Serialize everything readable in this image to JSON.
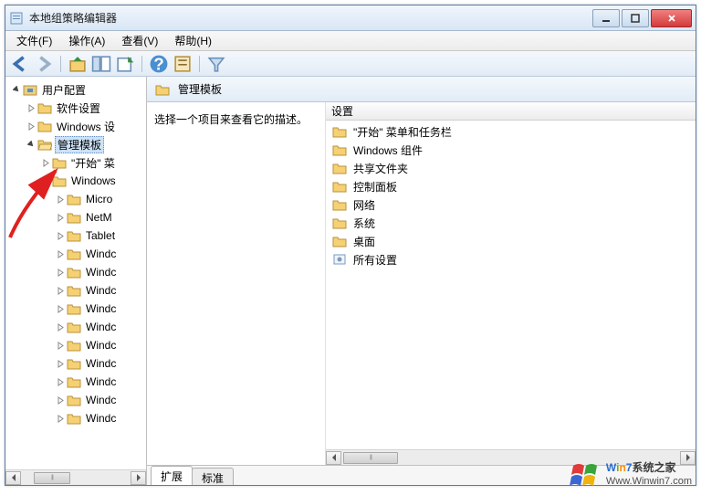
{
  "window": {
    "title": "本地组策略编辑器"
  },
  "menu": {
    "file": "文件(F)",
    "action": "操作(A)",
    "view": "查看(V)",
    "help": "帮助(H)"
  },
  "tree": {
    "user_config": "用户配置",
    "software_settings": "软件设置",
    "windows_settings": "Windows 设",
    "admin_templates": "管理模板",
    "start_taskbar": "\"开始\" 菜",
    "windows_comp": "Windows",
    "micro": "Micro",
    "netm": "NetM",
    "tablet": "Tablet",
    "windc": "Windc"
  },
  "right": {
    "header": "管理模板",
    "desc": "选择一个项目来查看它的描述。",
    "col_setting": "设置",
    "items": {
      "start_taskbar": "\"开始\" 菜单和任务栏",
      "windows_comp": "Windows 组件",
      "shared_folders": "共享文件夹",
      "control_panel": "控制面板",
      "network": "网络",
      "system": "系统",
      "desktop": "桌面",
      "all_settings": "所有设置"
    }
  },
  "tabs": {
    "extended": "扩展",
    "standard": "标准"
  },
  "watermark": {
    "brand": "Win7系统之家",
    "url": "Www.Winwin7.com"
  }
}
